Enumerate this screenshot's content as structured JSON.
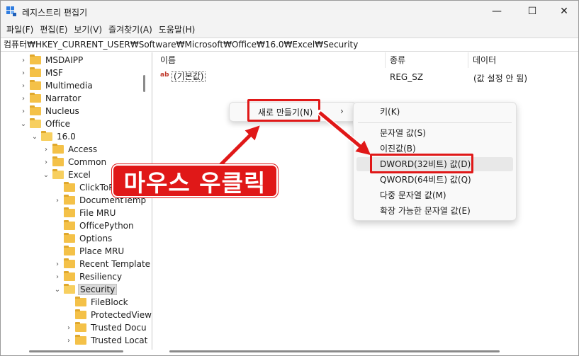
{
  "app": {
    "title": "레지스트리 편집기"
  },
  "window_controls": {
    "minimize": "—",
    "maximize": "☐",
    "close": "✕"
  },
  "menu": [
    "파일(F)",
    "편집(E)",
    "보기(V)",
    "즐겨찾기(A)",
    "도움말(H)"
  ],
  "address": "컴퓨터₩HKEY_CURRENT_USER₩Software₩Microsoft₩Office₩16.0₩Excel₩Security",
  "tree": [
    {
      "label": "MSDAIPP",
      "chev": "›",
      "level": 0
    },
    {
      "label": "MSF",
      "chev": "›",
      "level": 0
    },
    {
      "label": "Multimedia",
      "chev": "›",
      "level": 0
    },
    {
      "label": "Narrator",
      "chev": "›",
      "level": 0
    },
    {
      "label": "Nucleus",
      "chev": "›",
      "level": 0
    },
    {
      "label": "Office",
      "chev": "⌄",
      "level": 0
    },
    {
      "label": "16.0",
      "chev": "⌄",
      "level": 1
    },
    {
      "label": "Access",
      "chev": "›",
      "level": 2
    },
    {
      "label": "Common",
      "chev": "›",
      "level": 2
    },
    {
      "label": "Excel",
      "chev": "⌄",
      "level": 2
    },
    {
      "label": "ClickToRu",
      "chev": "",
      "level": 3
    },
    {
      "label": "DocumentTemp",
      "chev": "›",
      "level": 3
    },
    {
      "label": "File MRU",
      "chev": "",
      "level": 3
    },
    {
      "label": "OfficePython",
      "chev": "",
      "level": 3
    },
    {
      "label": "Options",
      "chev": "",
      "level": 3
    },
    {
      "label": "Place MRU",
      "chev": "",
      "level": 3
    },
    {
      "label": "Recent Template",
      "chev": "›",
      "level": 3
    },
    {
      "label": "Resiliency",
      "chev": "›",
      "level": 3
    },
    {
      "label": "Security",
      "chev": "⌄",
      "level": 3,
      "selected": true
    },
    {
      "label": "FileBlock",
      "chev": "",
      "level": 4
    },
    {
      "label": "ProtectedView",
      "chev": "",
      "level": 4
    },
    {
      "label": "Trusted Docu",
      "chev": "›",
      "level": 4
    },
    {
      "label": "Trusted Locat",
      "chev": "›",
      "level": 4
    }
  ],
  "columns": {
    "name": "이름",
    "type": "종류",
    "data": "데이터"
  },
  "value_row": {
    "icon": "ab",
    "name": "(기본값)",
    "type": "REG_SZ",
    "data": "(값 설정 안 됨)"
  },
  "context_menu": {
    "new_label": "새로 만들기(N)",
    "arrow": "›"
  },
  "submenu": {
    "key": "키(K)",
    "items": [
      "문자열 값(S)",
      "이진값(B)",
      "DWORD(32비트) 값(D)",
      "QWORD(64비트) 값(Q)",
      "다중 문자열 값(M)",
      "확장 가능한 문자열 값(E)"
    ]
  },
  "callout": "마우스 우클릭",
  "colors": {
    "accent_red": "#e01818",
    "folder": "#f4c148",
    "highlight": "#e8e8e8"
  }
}
